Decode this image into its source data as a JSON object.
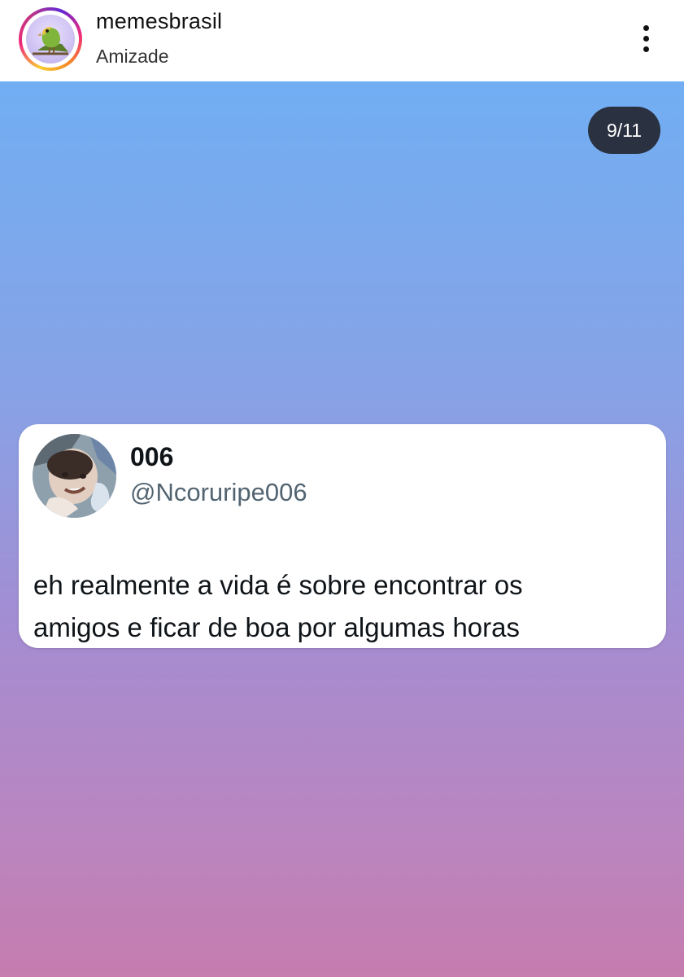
{
  "header": {
    "account_name": "memesbrasil",
    "subtitle": "Amizade",
    "avatar_icon": "parrot-icon",
    "more_icon": "more-vertical-icon"
  },
  "post": {
    "counter": "9/11",
    "gradient_colors": [
      "#71aef3",
      "#88a2e6",
      "#a38dd2",
      "#bb85bf",
      "#c57cae"
    ]
  },
  "tweet": {
    "display_name": "006",
    "handle": "@Ncoruripe006",
    "text_line1": "eh realmente a vida é sobre encontrar os",
    "text_line2": "amigos e ficar de boa por algumas horas"
  }
}
